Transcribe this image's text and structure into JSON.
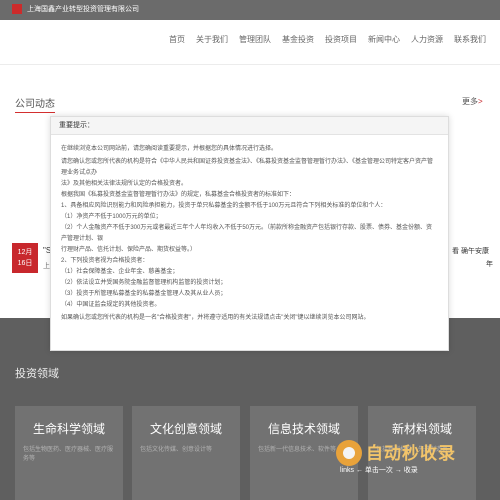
{
  "header": {
    "company": "上海国鑫产业转型投资管理有限公司",
    "nav": [
      "首页",
      "关于我们",
      "管理团队",
      "基金投资",
      "投资项目",
      "新闻中心",
      "人力资源",
      "联系我们"
    ]
  },
  "news": {
    "heading": "公司动态",
    "more": "更多",
    "more_arrow": ">",
    "date_month": "12月",
    "date_day": "16日",
    "left_text": "\"S",
    "left_text2": "上",
    "right_text": "看 确午安康",
    "right_text2": "年"
  },
  "modal": {
    "title": "重要提示：",
    "lines": [
      "在继续浏览本公司网站前，请您确阅读重要提示，并根据您的具体情况进行选择。",
      "请您确认您或您所代表的机构是符合《中华人民共和国证券投资基金法》、《私募投资基金监督管理暂行办法》、《基金管理公司特定客户资产管理业务试点办",
      "法》及其他相关法律法规所认定的合格投资者。",
      "根据我国《私募投资基金监督管理暂行办法》的规定，私募基金合格投资者的标准如下：",
      "1、具备相应风险识别能力和风险承担能力，投资于单只私募基金的金额不低于100万元且符合下列相关标准的单位和个人：",
      "（1）净资产不低于1000万元的单位；",
      "（2）个人金融资产不低于300万元或者最近三年个人年均收入不低于50万元。（前款所称金融资产包括银行存款、股票、债券、基金份额、资产管理计划、银",
      "行理财产品、信托计划、保险产品、期货权益等。）",
      "2、下列投资者视为合格投资者：",
      "（1）社会保障基金、企业年金、慈善基金；",
      "（2）依法设立并受国务院金融监督管理机构监管的投资计划；",
      "（3）投资于所管理私募基金的私募基金管理人及其从业人员；",
      "（4）中国证监会规定的其他投资者。",
      "如果确认您或您所代表的机构是一名\"合格投资者\"，并将遵守适用的有关法规请点击\"关闭\"键以继续浏览本公司网站。"
    ]
  },
  "investment": {
    "heading": "投资领域",
    "fields": [
      {
        "title": "生命科学领域",
        "desc": "包括生物医药、医疗器械、医疗服务等"
      },
      {
        "title": "文化创意领域",
        "desc": "包括文化传媒、创意设计等"
      },
      {
        "title": "信息技术领域",
        "desc": "包括新一代信息技术、软件等"
      },
      {
        "title": "新材料领域",
        "desc": "包括新型材料、先进制造等"
      }
    ]
  },
  "watermark": {
    "title": "自动秒收录",
    "subtitle": "links ← 单击一次 → 收录"
  },
  "colors": {
    "accent": "#c8282d",
    "topbar": "#6b6b6b",
    "section_bg": "#5f5f5f"
  }
}
